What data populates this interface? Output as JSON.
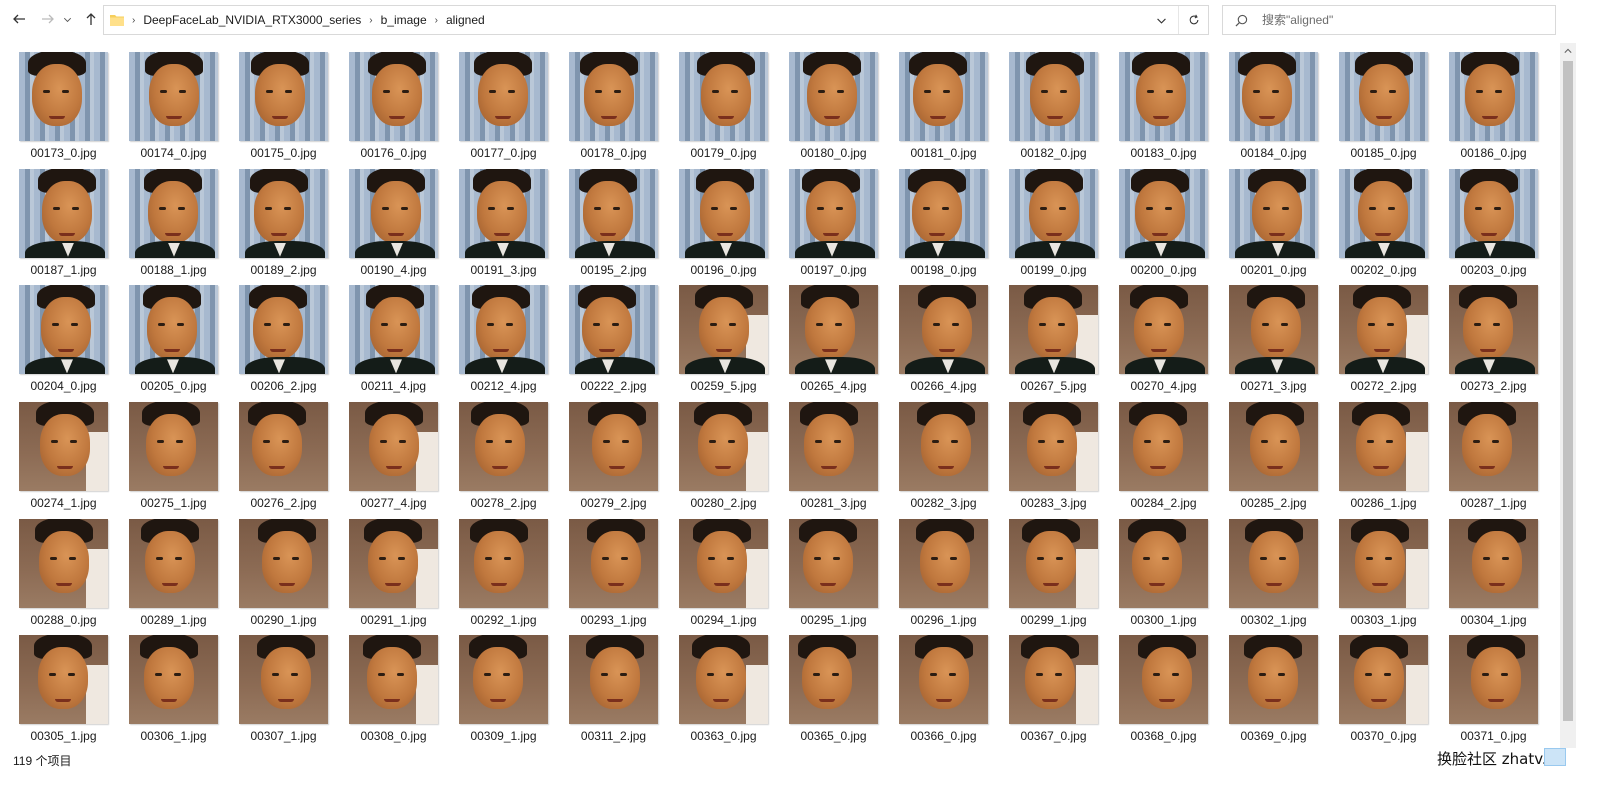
{
  "nav": {
    "back_icon": "arrow-left-icon",
    "forward_icon": "arrow-right-icon",
    "recent_icon": "chevron-down-icon",
    "up_icon": "arrow-up-icon"
  },
  "address": {
    "breadcrumbs": [
      "DeepFaceLab_NVIDIA_RTX3000_series",
      "b_image",
      "aligned"
    ],
    "dropdown_icon": "chevron-down-icon",
    "refresh_icon": "refresh-icon"
  },
  "search": {
    "placeholder": "搜索\"aligned\""
  },
  "files": [
    "00173_0.jpg",
    "00174_0.jpg",
    "00175_0.jpg",
    "00176_0.jpg",
    "00177_0.jpg",
    "00178_0.jpg",
    "00179_0.jpg",
    "00180_0.jpg",
    "00181_0.jpg",
    "00182_0.jpg",
    "00183_0.jpg",
    "00184_0.jpg",
    "00185_0.jpg",
    "00186_0.jpg",
    "00187_1.jpg",
    "00188_1.jpg",
    "00189_2.jpg",
    "00190_4.jpg",
    "00191_3.jpg",
    "00195_2.jpg",
    "00196_0.jpg",
    "00197_0.jpg",
    "00198_0.jpg",
    "00199_0.jpg",
    "00200_0.jpg",
    "00201_0.jpg",
    "00202_0.jpg",
    "00203_0.jpg",
    "00204_0.jpg",
    "00205_0.jpg",
    "00206_2.jpg",
    "00211_4.jpg",
    "00212_4.jpg",
    "00222_2.jpg",
    "00259_5.jpg",
    "00265_4.jpg",
    "00266_4.jpg",
    "00267_5.jpg",
    "00270_4.jpg",
    "00271_3.jpg",
    "00272_2.jpg",
    "00273_2.jpg",
    "00274_1.jpg",
    "00275_1.jpg",
    "00276_2.jpg",
    "00277_4.jpg",
    "00278_2.jpg",
    "00279_2.jpg",
    "00280_2.jpg",
    "00281_3.jpg",
    "00282_3.jpg",
    "00283_3.jpg",
    "00284_2.jpg",
    "00285_2.jpg",
    "00286_1.jpg",
    "00287_1.jpg",
    "00288_0.jpg",
    "00289_1.jpg",
    "00290_1.jpg",
    "00291_1.jpg",
    "00292_1.jpg",
    "00293_1.jpg",
    "00294_1.jpg",
    "00295_1.jpg",
    "00296_1.jpg",
    "00299_1.jpg",
    "00300_1.jpg",
    "00302_1.jpg",
    "00303_1.jpg",
    "00304_1.jpg",
    "00305_1.jpg",
    "00306_1.jpg",
    "00307_1.jpg",
    "00308_0.jpg",
    "00309_1.jpg",
    "00311_2.jpg",
    "00363_0.jpg",
    "00365_0.jpg",
    "00366_0.jpg",
    "00367_0.jpg",
    "00368_0.jpg",
    "00369_0.jpg",
    "00370_0.jpg",
    "00371_0.jpg"
  ],
  "status": {
    "item_count": "119 个项目"
  },
  "watermark": "换脸社区 zhatv.cn",
  "colors": {
    "bg_blue": "#8ea4bc",
    "bg_brown": "#8a6a52",
    "skin": "#c0783e",
    "accent": "#cce4f7"
  }
}
